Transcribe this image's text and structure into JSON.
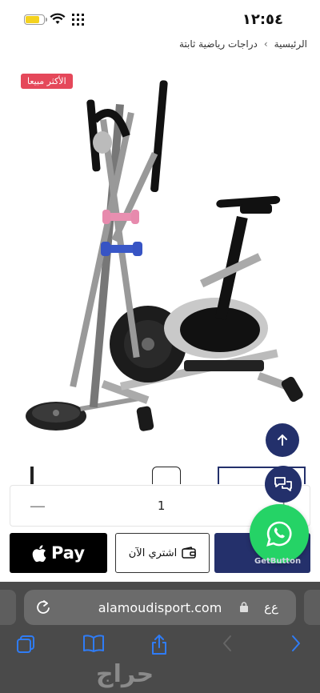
{
  "status": {
    "time": "١٢:٥٤"
  },
  "breadcrumb": {
    "home": "الرئيسية",
    "separator": "›",
    "category": "دراجات رياضية ثابتة"
  },
  "product": {
    "badge": "الأكثر مبيعا",
    "image_icon": "elliptical-bike-image"
  },
  "quantity": {
    "minus": "—",
    "value": "1",
    "plus": "+"
  },
  "buttons": {
    "apple_pay": " Pay",
    "buy_now": "اشتري الآن"
  },
  "floating": {
    "getbutton": "GetButton"
  },
  "browser": {
    "url": "alamoudisport.com",
    "aa": "ﻉﻉ"
  },
  "watermark": "حراج",
  "colors": {
    "brand_navy": "#24306b",
    "badge_red": "#e5485a",
    "whatsapp_green": "#25d366",
    "browser_bg": "#4a4a4a",
    "toolbar_blue": "#2f7cf6"
  }
}
